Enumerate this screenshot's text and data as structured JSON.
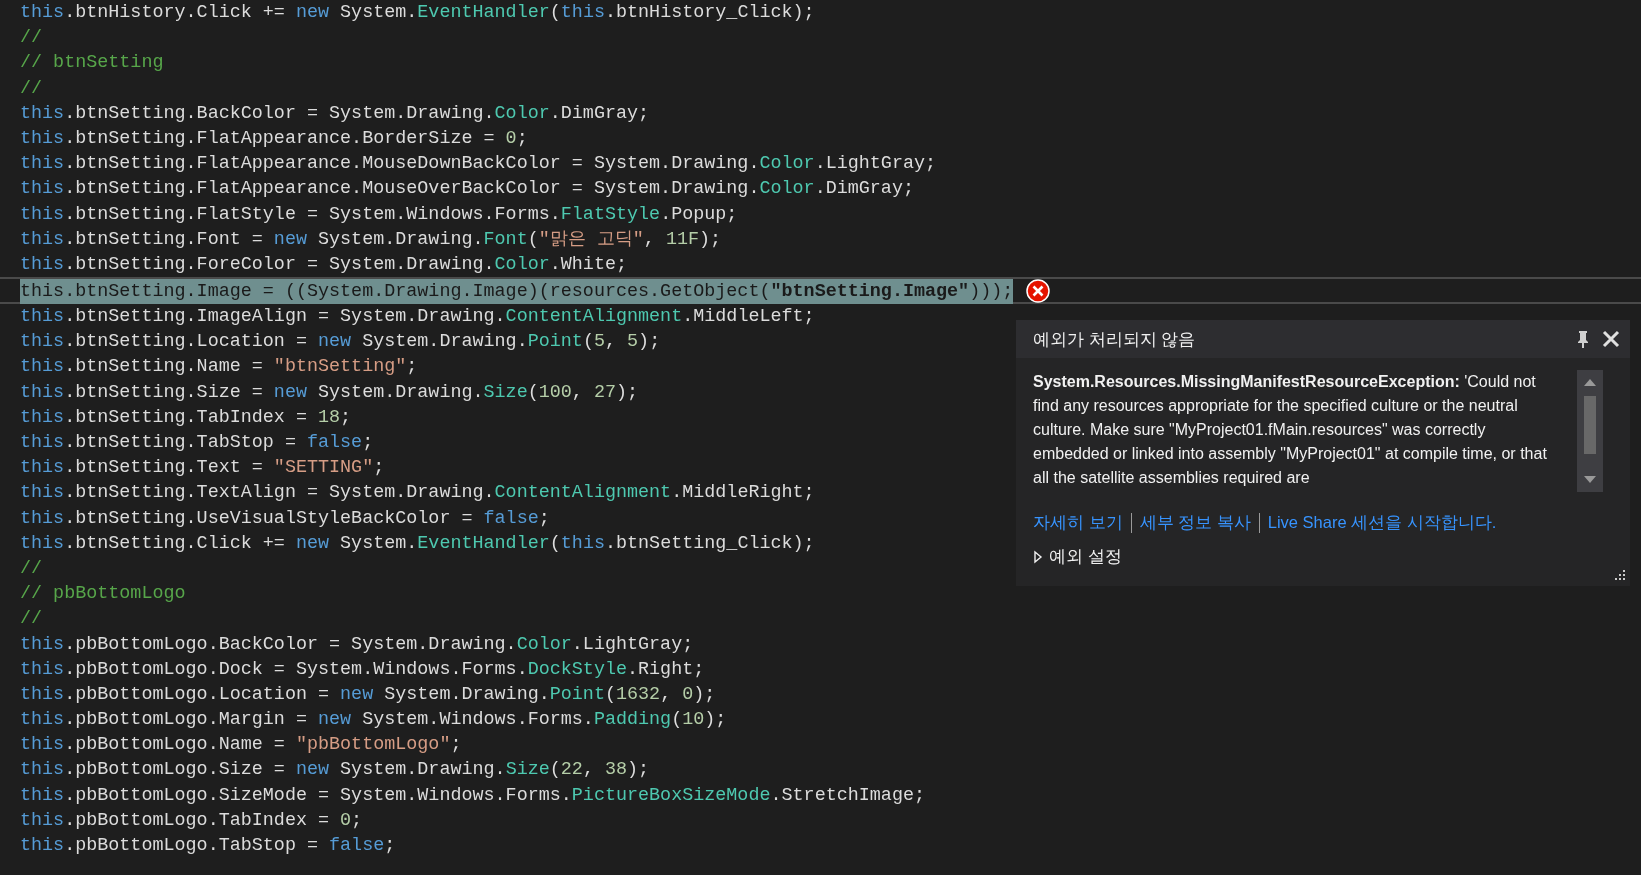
{
  "editor": {
    "lines": [
      {
        "selected": false,
        "tokens": [
          {
            "kind": "kw",
            "text": "this"
          },
          {
            "kind": "p",
            "text": ".btnHistory.Click += "
          },
          {
            "kind": "kw",
            "text": "new"
          },
          {
            "kind": "p",
            "text": " System."
          },
          {
            "kind": "ty",
            "text": "EventHandler"
          },
          {
            "kind": "p",
            "text": "("
          },
          {
            "kind": "kw",
            "text": "this"
          },
          {
            "kind": "p",
            "text": ".btnHistory_Click);"
          }
        ]
      },
      {
        "selected": false,
        "tokens": [
          {
            "kind": "cm",
            "text": "//"
          }
        ]
      },
      {
        "selected": false,
        "tokens": [
          {
            "kind": "cm",
            "text": "// btnSetting"
          }
        ]
      },
      {
        "selected": false,
        "tokens": [
          {
            "kind": "cm",
            "text": "//"
          }
        ]
      },
      {
        "selected": false,
        "tokens": [
          {
            "kind": "kw",
            "text": "this"
          },
          {
            "kind": "p",
            "text": ".btnSetting.BackColor = System.Drawing."
          },
          {
            "kind": "ty",
            "text": "Color"
          },
          {
            "kind": "p",
            "text": ".DimGray;"
          }
        ]
      },
      {
        "selected": false,
        "tokens": [
          {
            "kind": "kw",
            "text": "this"
          },
          {
            "kind": "p",
            "text": ".btnSetting.FlatAppearance.BorderSize = "
          },
          {
            "kind": "num",
            "text": "0"
          },
          {
            "kind": "p",
            "text": ";"
          }
        ]
      },
      {
        "selected": false,
        "tokens": [
          {
            "kind": "kw",
            "text": "this"
          },
          {
            "kind": "p",
            "text": ".btnSetting.FlatAppearance.MouseDownBackColor = System.Drawing."
          },
          {
            "kind": "ty",
            "text": "Color"
          },
          {
            "kind": "p",
            "text": ".LightGray;"
          }
        ]
      },
      {
        "selected": false,
        "tokens": [
          {
            "kind": "kw",
            "text": "this"
          },
          {
            "kind": "p",
            "text": ".btnSetting.FlatAppearance.MouseOverBackColor = System.Drawing."
          },
          {
            "kind": "ty",
            "text": "Color"
          },
          {
            "kind": "p",
            "text": ".DimGray;"
          }
        ]
      },
      {
        "selected": false,
        "tokens": [
          {
            "kind": "kw",
            "text": "this"
          },
          {
            "kind": "p",
            "text": ".btnSetting.FlatStyle = System.Windows.Forms."
          },
          {
            "kind": "ty",
            "text": "FlatStyle"
          },
          {
            "kind": "p",
            "text": ".Popup;"
          }
        ]
      },
      {
        "selected": false,
        "tokens": [
          {
            "kind": "kw",
            "text": "this"
          },
          {
            "kind": "p",
            "text": ".btnSetting.Font = "
          },
          {
            "kind": "kw",
            "text": "new"
          },
          {
            "kind": "p",
            "text": " System.Drawing."
          },
          {
            "kind": "ty",
            "text": "Font"
          },
          {
            "kind": "p",
            "text": "("
          },
          {
            "kind": "str",
            "text": "\"맑은 고딕\""
          },
          {
            "kind": "p",
            "text": ", "
          },
          {
            "kind": "num",
            "text": "11F"
          },
          {
            "kind": "p",
            "text": ");"
          }
        ]
      },
      {
        "selected": false,
        "tokens": [
          {
            "kind": "kw",
            "text": "this"
          },
          {
            "kind": "p",
            "text": ".btnSetting.ForeColor = System.Drawing."
          },
          {
            "kind": "ty",
            "text": "Color"
          },
          {
            "kind": "p",
            "text": ".White;"
          }
        ]
      },
      {
        "selected": true,
        "tokens": [
          {
            "kind": "kw",
            "text": "this"
          },
          {
            "kind": "p",
            "text": ".btnSetting.Image = ((System.Drawing."
          },
          {
            "kind": "ty",
            "text": "Image"
          },
          {
            "kind": "p",
            "text": ")(resources.GetObject("
          },
          {
            "kind": "str",
            "text": "\"btnSetting.Image\""
          },
          {
            "kind": "p",
            "text": ")));"
          }
        ]
      },
      {
        "selected": false,
        "tokens": [
          {
            "kind": "kw",
            "text": "this"
          },
          {
            "kind": "p",
            "text": ".btnSetting.ImageAlign = System.Drawing."
          },
          {
            "kind": "ty",
            "text": "ContentAlignment"
          },
          {
            "kind": "p",
            "text": ".MiddleLeft;"
          }
        ]
      },
      {
        "selected": false,
        "tokens": [
          {
            "kind": "kw",
            "text": "this"
          },
          {
            "kind": "p",
            "text": ".btnSetting.Location = "
          },
          {
            "kind": "kw",
            "text": "new"
          },
          {
            "kind": "p",
            "text": " System.Drawing."
          },
          {
            "kind": "ty",
            "text": "Point"
          },
          {
            "kind": "p",
            "text": "("
          },
          {
            "kind": "num",
            "text": "5"
          },
          {
            "kind": "p",
            "text": ", "
          },
          {
            "kind": "num",
            "text": "5"
          },
          {
            "kind": "p",
            "text": ");"
          }
        ]
      },
      {
        "selected": false,
        "tokens": [
          {
            "kind": "kw",
            "text": "this"
          },
          {
            "kind": "p",
            "text": ".btnSetting.Name = "
          },
          {
            "kind": "str",
            "text": "\"btnSetting\""
          },
          {
            "kind": "p",
            "text": ";"
          }
        ]
      },
      {
        "selected": false,
        "tokens": [
          {
            "kind": "kw",
            "text": "this"
          },
          {
            "kind": "p",
            "text": ".btnSetting.Size = "
          },
          {
            "kind": "kw",
            "text": "new"
          },
          {
            "kind": "p",
            "text": " System.Drawing."
          },
          {
            "kind": "ty",
            "text": "Size"
          },
          {
            "kind": "p",
            "text": "("
          },
          {
            "kind": "num",
            "text": "100"
          },
          {
            "kind": "p",
            "text": ", "
          },
          {
            "kind": "num",
            "text": "27"
          },
          {
            "kind": "p",
            "text": ");"
          }
        ]
      },
      {
        "selected": false,
        "tokens": [
          {
            "kind": "kw",
            "text": "this"
          },
          {
            "kind": "p",
            "text": ".btnSetting.TabIndex = "
          },
          {
            "kind": "num",
            "text": "18"
          },
          {
            "kind": "p",
            "text": ";"
          }
        ]
      },
      {
        "selected": false,
        "tokens": [
          {
            "kind": "kw",
            "text": "this"
          },
          {
            "kind": "p",
            "text": ".btnSetting.TabStop = "
          },
          {
            "kind": "kw",
            "text": "false"
          },
          {
            "kind": "p",
            "text": ";"
          }
        ]
      },
      {
        "selected": false,
        "tokens": [
          {
            "kind": "kw",
            "text": "this"
          },
          {
            "kind": "p",
            "text": ".btnSetting.Text = "
          },
          {
            "kind": "str",
            "text": "\"SETTING\""
          },
          {
            "kind": "p",
            "text": ";"
          }
        ]
      },
      {
        "selected": false,
        "tokens": [
          {
            "kind": "kw",
            "text": "this"
          },
          {
            "kind": "p",
            "text": ".btnSetting.TextAlign = System.Drawing."
          },
          {
            "kind": "ty",
            "text": "ContentAlignment"
          },
          {
            "kind": "p",
            "text": ".MiddleRight;"
          }
        ]
      },
      {
        "selected": false,
        "tokens": [
          {
            "kind": "kw",
            "text": "this"
          },
          {
            "kind": "p",
            "text": ".btnSetting.UseVisualStyleBackColor = "
          },
          {
            "kind": "kw",
            "text": "false"
          },
          {
            "kind": "p",
            "text": ";"
          }
        ]
      },
      {
        "selected": false,
        "tokens": [
          {
            "kind": "kw",
            "text": "this"
          },
          {
            "kind": "p",
            "text": ".btnSetting.Click += "
          },
          {
            "kind": "kw",
            "text": "new"
          },
          {
            "kind": "p",
            "text": " System."
          },
          {
            "kind": "ty",
            "text": "EventHandler"
          },
          {
            "kind": "p",
            "text": "("
          },
          {
            "kind": "kw",
            "text": "this"
          },
          {
            "kind": "p",
            "text": ".btnSetting_Click);"
          }
        ]
      },
      {
        "selected": false,
        "tokens": [
          {
            "kind": "cm",
            "text": "//"
          }
        ]
      },
      {
        "selected": false,
        "tokens": [
          {
            "kind": "cm",
            "text": "// pbBottomLogo"
          }
        ]
      },
      {
        "selected": false,
        "tokens": [
          {
            "kind": "cm",
            "text": "//"
          }
        ]
      },
      {
        "selected": false,
        "tokens": [
          {
            "kind": "kw",
            "text": "this"
          },
          {
            "kind": "p",
            "text": ".pbBottomLogo.BackColor = System.Drawing."
          },
          {
            "kind": "ty",
            "text": "Color"
          },
          {
            "kind": "p",
            "text": ".LightGray;"
          }
        ]
      },
      {
        "selected": false,
        "tokens": [
          {
            "kind": "kw",
            "text": "this"
          },
          {
            "kind": "p",
            "text": ".pbBottomLogo.Dock = System.Windows.Forms."
          },
          {
            "kind": "ty",
            "text": "DockStyle"
          },
          {
            "kind": "p",
            "text": ".Right;"
          }
        ]
      },
      {
        "selected": false,
        "tokens": [
          {
            "kind": "kw",
            "text": "this"
          },
          {
            "kind": "p",
            "text": ".pbBottomLogo.Location = "
          },
          {
            "kind": "kw",
            "text": "new"
          },
          {
            "kind": "p",
            "text": " System.Drawing."
          },
          {
            "kind": "ty",
            "text": "Point"
          },
          {
            "kind": "p",
            "text": "("
          },
          {
            "kind": "num",
            "text": "1632"
          },
          {
            "kind": "p",
            "text": ", "
          },
          {
            "kind": "num",
            "text": "0"
          },
          {
            "kind": "p",
            "text": ");"
          }
        ]
      },
      {
        "selected": false,
        "tokens": [
          {
            "kind": "kw",
            "text": "this"
          },
          {
            "kind": "p",
            "text": ".pbBottomLogo.Margin = "
          },
          {
            "kind": "kw",
            "text": "new"
          },
          {
            "kind": "p",
            "text": " System.Windows.Forms."
          },
          {
            "kind": "ty",
            "text": "Padding"
          },
          {
            "kind": "p",
            "text": "("
          },
          {
            "kind": "num",
            "text": "10"
          },
          {
            "kind": "p",
            "text": ");"
          }
        ]
      },
      {
        "selected": false,
        "tokens": [
          {
            "kind": "kw",
            "text": "this"
          },
          {
            "kind": "p",
            "text": ".pbBottomLogo.Name = "
          },
          {
            "kind": "str",
            "text": "\"pbBottomLogo\""
          },
          {
            "kind": "p",
            "text": ";"
          }
        ]
      },
      {
        "selected": false,
        "tokens": [
          {
            "kind": "kw",
            "text": "this"
          },
          {
            "kind": "p",
            "text": ".pbBottomLogo.Size = "
          },
          {
            "kind": "kw",
            "text": "new"
          },
          {
            "kind": "p",
            "text": " System.Drawing."
          },
          {
            "kind": "ty",
            "text": "Size"
          },
          {
            "kind": "p",
            "text": "("
          },
          {
            "kind": "num",
            "text": "22"
          },
          {
            "kind": "p",
            "text": ", "
          },
          {
            "kind": "num",
            "text": "38"
          },
          {
            "kind": "p",
            "text": ");"
          }
        ]
      },
      {
        "selected": false,
        "tokens": [
          {
            "kind": "kw",
            "text": "this"
          },
          {
            "kind": "p",
            "text": ".pbBottomLogo.SizeMode = System.Windows.Forms."
          },
          {
            "kind": "ty",
            "text": "PictureBoxSizeMode"
          },
          {
            "kind": "p",
            "text": ".StretchImage;"
          }
        ]
      },
      {
        "selected": false,
        "tokens": [
          {
            "kind": "kw",
            "text": "this"
          },
          {
            "kind": "p",
            "text": ".pbBottomLogo.TabIndex = "
          },
          {
            "kind": "num",
            "text": "0"
          },
          {
            "kind": "p",
            "text": ";"
          }
        ]
      },
      {
        "selected": false,
        "tokens": [
          {
            "kind": "kw",
            "text": "this"
          },
          {
            "kind": "p",
            "text": ".pbBottomLogo.TabStop = "
          },
          {
            "kind": "kw",
            "text": "false"
          },
          {
            "kind": "p",
            "text": ";"
          }
        ]
      }
    ]
  },
  "exception_popup": {
    "title": "예외가 처리되지 않음",
    "message": "**System.Resources.MissingManifestResourceException:** 'Could not find any resources appropriate for the specified culture or the neutral culture. Make sure \"MyProject01.fMain.resources\" was correctly embedded or linked into assembly \"MyProject01\" at compile time, or that all the satellite assemblies required are",
    "links": [
      "자세히 보기",
      "세부 정보 복사",
      "Live Share 세션을 시작합니다."
    ],
    "settings": {
      "label": "예외 설정",
      "expanded": false
    }
  }
}
